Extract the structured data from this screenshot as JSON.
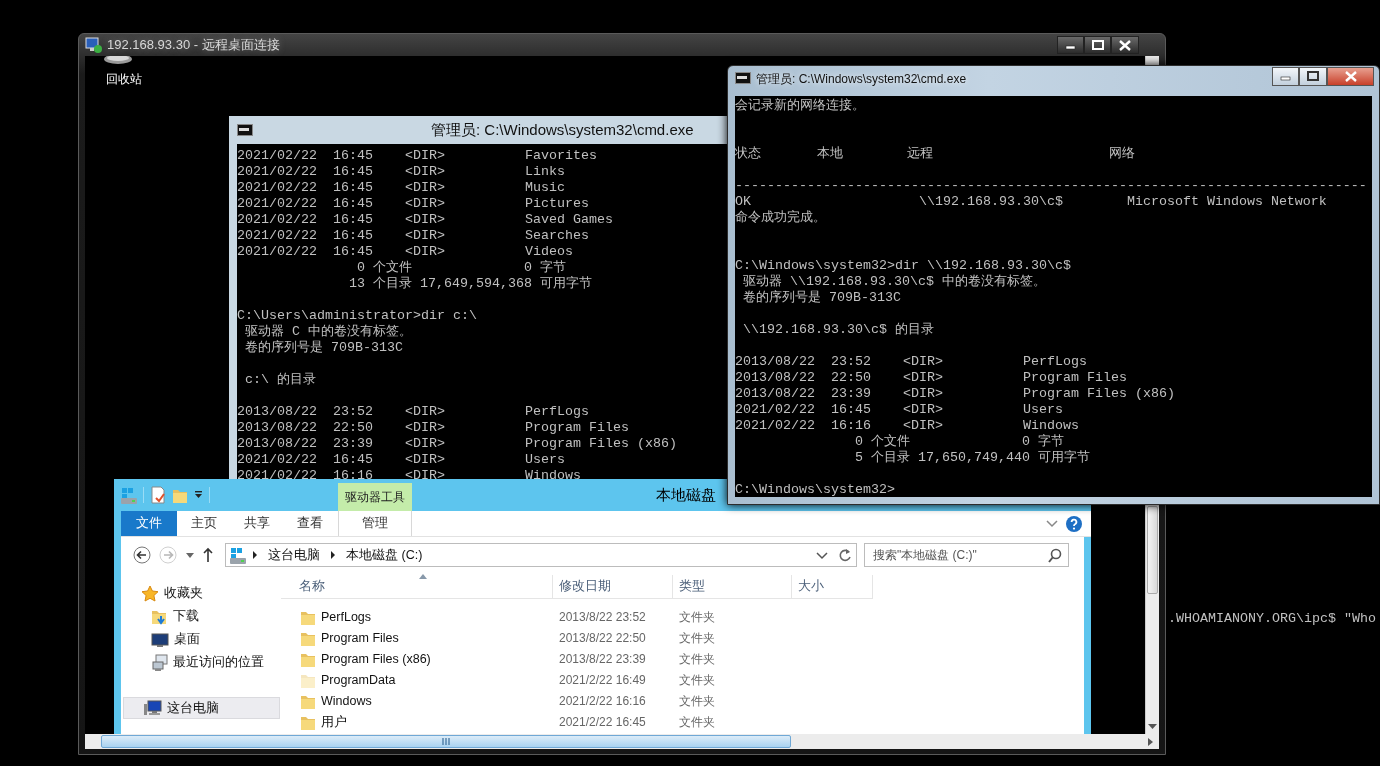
{
  "remote_window": {
    "title": "192.168.93.30 - 远程桌面连接"
  },
  "desktop_icons": [
    {
      "label": "回收站"
    }
  ],
  "console_back": {
    "title": "管理员: C:\\Windows\\system32\\cmd.exe",
    "lines": [
      {
        "kind": "text",
        "text": "2021/02/22  16:45    <DIR>          Favorites"
      },
      {
        "kind": "text",
        "text": "2021/02/22  16:45    <DIR>          Links"
      },
      {
        "kind": "text",
        "text": "2021/02/22  16:45    <DIR>          Music"
      },
      {
        "kind": "text",
        "text": "2021/02/22  16:45    <DIR>          Pictures"
      },
      {
        "kind": "text",
        "text": "2021/02/22  16:45    <DIR>          Saved Games"
      },
      {
        "kind": "text",
        "text": "2021/02/22  16:45    <DIR>          Searches"
      },
      {
        "kind": "text",
        "text": "2021/02/22  16:45    <DIR>          Videos"
      },
      {
        "kind": "text",
        "text": "               0 个文件              0 字节"
      },
      {
        "kind": "text",
        "text": "              13 个目录 17,649,594,368 可用字节"
      },
      {
        "kind": "blank"
      },
      {
        "kind": "text",
        "text": "C:\\Users\\administrator>dir c:\\"
      },
      {
        "kind": "text",
        "text": " 驱动器 C 中的卷没有标签。"
      },
      {
        "kind": "text",
        "text": " 卷的序列号是 709B-313C"
      },
      {
        "kind": "blank"
      },
      {
        "kind": "text",
        "text": " c:\\ 的目录"
      },
      {
        "kind": "blank"
      },
      {
        "kind": "text",
        "text": "2013/08/22  23:52    <DIR>          PerfLogs"
      },
      {
        "kind": "text",
        "text": "2013/08/22  22:50    <DIR>          Program Files"
      },
      {
        "kind": "text",
        "text": "2013/08/22  23:39    <DIR>          Program Files (x86)"
      },
      {
        "kind": "text",
        "text": "2021/02/22  16:45    <DIR>          Users"
      },
      {
        "kind": "text",
        "text": "2021/02/22  16:16    <DIR>          Windows"
      }
    ]
  },
  "console_front": {
    "title": "管理员: C:\\Windows\\system32\\cmd.exe",
    "lines": [
      {
        "kind": "text",
        "text": "会记录新的网络连接。"
      },
      {
        "kind": "blank"
      },
      {
        "kind": "blank"
      },
      {
        "kind": "text",
        "text": "状态       本地        远程                      网络"
      },
      {
        "kind": "blank"
      },
      {
        "kind": "text",
        "text": "-------------------------------------------------------------------------------"
      },
      {
        "kind": "text",
        "text": "OK                     \\\\192.168.93.30\\c$        Microsoft Windows Network"
      },
      {
        "kind": "text",
        "text": "命令成功完成。"
      },
      {
        "kind": "blank"
      },
      {
        "kind": "blank"
      },
      {
        "kind": "text",
        "text": "C:\\Windows\\system32>dir \\\\192.168.93.30\\c$"
      },
      {
        "kind": "text",
        "text": " 驱动器 \\\\192.168.93.30\\c$ 中的卷没有标签。"
      },
      {
        "kind": "text",
        "text": " 卷的序列号是 709B-313C"
      },
      {
        "kind": "blank"
      },
      {
        "kind": "text",
        "text": " \\\\192.168.93.30\\c$ 的目录"
      },
      {
        "kind": "blank"
      },
      {
        "kind": "text",
        "text": "2013/08/22  23:52    <DIR>          PerfLogs"
      },
      {
        "kind": "text",
        "text": "2013/08/22  22:50    <DIR>          Program Files"
      },
      {
        "kind": "text",
        "text": "2013/08/22  23:39    <DIR>          Program Files (x86)"
      },
      {
        "kind": "text",
        "text": "2021/02/22  16:45    <DIR>          Users"
      },
      {
        "kind": "text",
        "text": "2021/02/22  16:16    <DIR>          Windows"
      },
      {
        "kind": "text",
        "text": "               0 个文件              0 字节"
      },
      {
        "kind": "text",
        "text": "               5 个目录 17,650,749,440 可用字节"
      },
      {
        "kind": "blank"
      },
      {
        "kind": "text",
        "text": "C:\\Windows\\system32>"
      }
    ]
  },
  "explorer": {
    "title": "本地磁盘",
    "context_group": "驱动器工具",
    "ribbon_tabs": [
      {
        "label": "文件",
        "kind": "file",
        "selected": false
      },
      {
        "label": "主页",
        "kind": "tab",
        "selected": false
      },
      {
        "label": "共享",
        "kind": "tab",
        "selected": false
      },
      {
        "label": "查看",
        "kind": "tab",
        "selected": false
      },
      {
        "label": "管理",
        "kind": "context",
        "selected": false
      }
    ],
    "nav_buttons": [
      {
        "kind": "back",
        "disabled": false
      },
      {
        "kind": "forward",
        "disabled": true
      },
      {
        "kind": "recent",
        "disabled": false
      },
      {
        "kind": "up",
        "disabled": false
      }
    ],
    "address": [
      "这台电脑",
      "本地磁盘 (C:)"
    ],
    "search": {
      "placeholder": "搜索\"本地磁盘 (C:)\""
    },
    "nav_pane": [
      {
        "label": "收藏夹",
        "kind": "favorites",
        "selected": false,
        "children": [
          {
            "label": "下载",
            "kind": "downloads",
            "selected": false
          },
          {
            "label": "桌面",
            "kind": "desktop",
            "selected": false
          },
          {
            "label": "最近访问的位置",
            "kind": "recent",
            "selected": false
          }
        ]
      },
      {
        "label": "这台电脑",
        "kind": "pc",
        "selected": true
      }
    ],
    "columns": [
      {
        "label": "名称",
        "sorted": true
      },
      {
        "label": "修改日期",
        "sorted": false
      },
      {
        "label": "类型",
        "sorted": false
      },
      {
        "label": "大小",
        "sorted": false
      }
    ],
    "rows": [
      {
        "name": "PerfLogs",
        "modified": "2013/8/22 23:52",
        "type": "文件夹",
        "hidden": false
      },
      {
        "name": "Program Files",
        "modified": "2013/8/22 22:50",
        "type": "文件夹",
        "hidden": false
      },
      {
        "name": "Program Files (x86)",
        "modified": "2013/8/22 23:39",
        "type": "文件夹",
        "hidden": false
      },
      {
        "name": "ProgramData",
        "modified": "2021/2/22 16:49",
        "type": "文件夹",
        "hidden": true
      },
      {
        "name": "Windows",
        "modified": "2021/2/22 16:16",
        "type": "文件夹",
        "hidden": false
      },
      {
        "name": "用户",
        "modified": "2021/2/22 16:45",
        "type": "文件夹",
        "hidden": false
      }
    ]
  },
  "background_console": {
    "lines": [
      ".WHOAMIANONY.ORG\\ipc$ \"Who"
    ]
  }
}
